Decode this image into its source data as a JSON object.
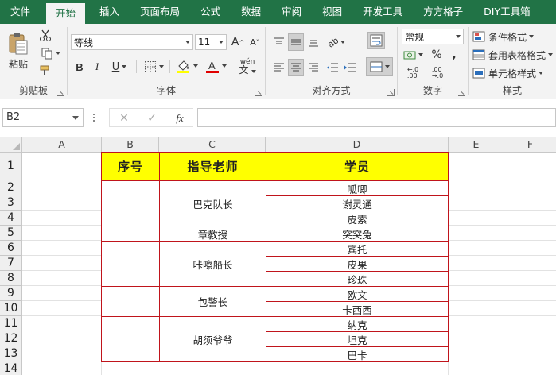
{
  "tabs": [
    {
      "label": "文件",
      "active": false
    },
    {
      "label": "开始",
      "active": true
    },
    {
      "label": "插入",
      "active": false
    },
    {
      "label": "页面布局",
      "active": false
    },
    {
      "label": "公式",
      "active": false
    },
    {
      "label": "数据",
      "active": false
    },
    {
      "label": "审阅",
      "active": false
    },
    {
      "label": "视图",
      "active": false
    },
    {
      "label": "开发工具",
      "active": false
    },
    {
      "label": "方方格子",
      "active": false
    },
    {
      "label": "DIY工具箱",
      "active": false
    }
  ],
  "ribbon": {
    "clipboard": {
      "label": "剪贴板",
      "paste_label": "粘贴"
    },
    "font": {
      "label": "字体",
      "font_name": "等线",
      "font_size": "11",
      "bold": "B",
      "italic": "I",
      "underline": "U",
      "wen_label": "wén"
    },
    "alignment": {
      "label": "对齐方式"
    },
    "number": {
      "label": "数字",
      "format": "常规"
    },
    "styles": {
      "label": "样式",
      "conditional": "条件格式",
      "table_format": "套用表格格式",
      "cell_styles": "单元格样式"
    },
    "accent_color": "#217346",
    "font_color": "#e00000"
  },
  "formula_bar": {
    "name_box": "B2",
    "fx": "fx",
    "value": ""
  },
  "columns": [
    "A",
    "B",
    "C",
    "D",
    "E",
    "F"
  ],
  "rows": [
    "1",
    "2",
    "3",
    "4",
    "5",
    "6",
    "7",
    "8",
    "9",
    "10",
    "11",
    "12",
    "13",
    "14"
  ],
  "table": {
    "header": {
      "seq": "序号",
      "teacher": "指导老师",
      "students": "学员"
    },
    "header_color": "#ffff00",
    "border_color": "#c0141b",
    "groups": [
      {
        "teacher": "巴克队长",
        "students": [
          "呱唧",
          "谢灵通",
          "皮索"
        ]
      },
      {
        "teacher": "章教授",
        "students": [
          "突突兔"
        ]
      },
      {
        "teacher": "咔嚓船长",
        "students": [
          "宾托",
          "皮果",
          "珍珠"
        ]
      },
      {
        "teacher": "包警长",
        "students": [
          "欧文",
          "卡西西"
        ]
      },
      {
        "teacher": "胡须爷爷",
        "students": [
          "纳克",
          "坦克",
          "巴卡"
        ]
      }
    ]
  }
}
